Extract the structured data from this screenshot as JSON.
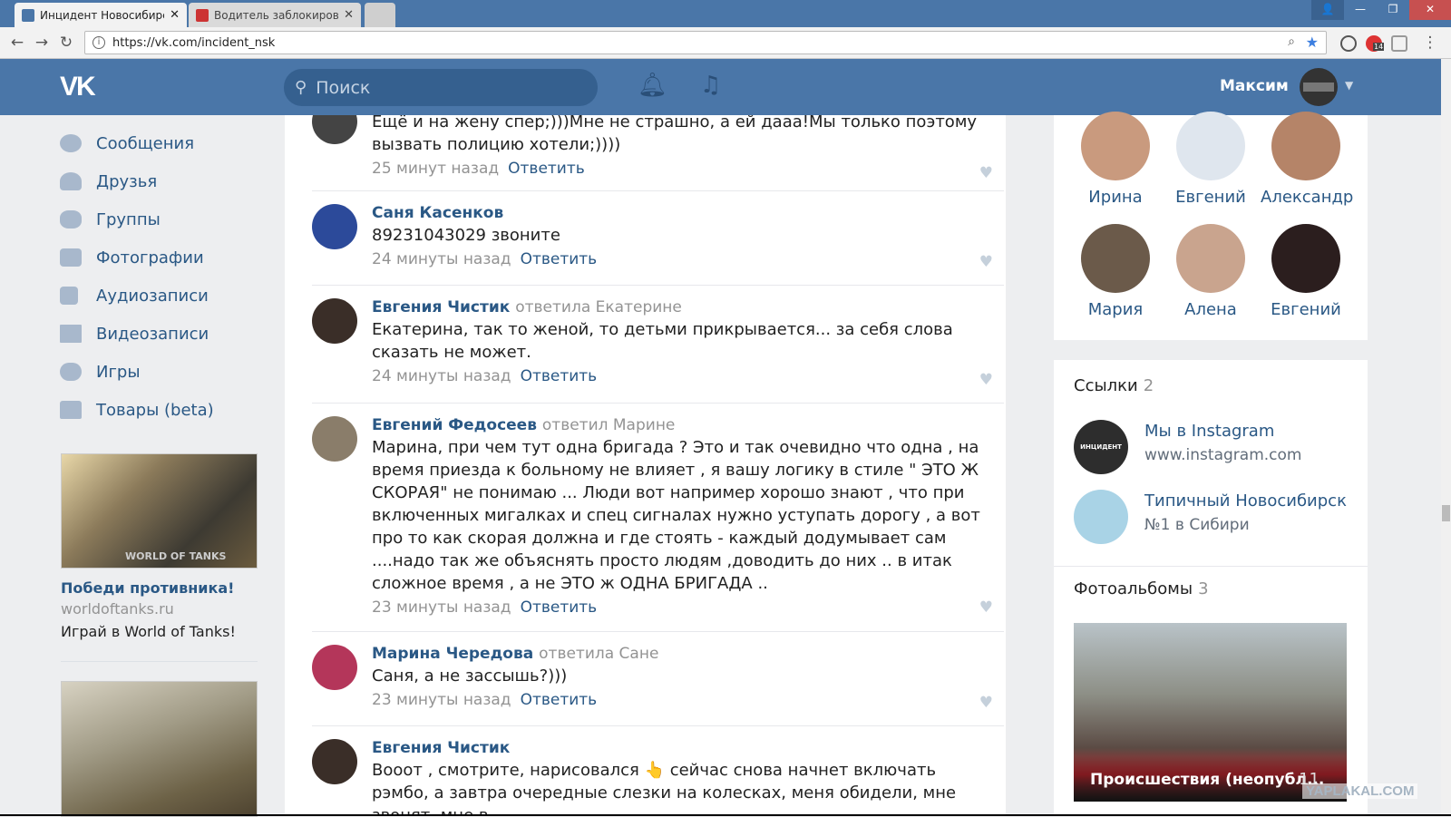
{
  "browser": {
    "tabs": [
      {
        "title": "Инцидент Новосибирск",
        "active": true
      },
      {
        "title": "Водитель заблокировал",
        "active": false
      }
    ],
    "url": "https://vk.com/incident_nsk",
    "ext_badge": "14"
  },
  "header": {
    "logo": "VK",
    "search_placeholder": "Поиск",
    "user_name": "Максим"
  },
  "leftnav": {
    "items": [
      {
        "label": "Сообщения"
      },
      {
        "label": "Друзья"
      },
      {
        "label": "Группы"
      },
      {
        "label": "Фотографии"
      },
      {
        "label": "Аудиозаписи"
      },
      {
        "label": "Видеозаписи"
      },
      {
        "label": "Игры"
      },
      {
        "label": "Товары (beta)"
      }
    ]
  },
  "ad": {
    "title": "Победи противника!",
    "domain": "worldoftanks.ru",
    "subtitle": "Играй в World of Tanks!",
    "img_text": "WORLD OF TANKS"
  },
  "comments": [
    {
      "name": "",
      "reply_to": "",
      "text": "Ещё и на жену спер;)))Мне не страшно, а ей дааа!Мы только поэтому вызвать полицию хотели;))))",
      "time": "25 минут назад",
      "reply": "Ответить"
    },
    {
      "name": "Саня Касенков",
      "reply_to": "",
      "text": "89231043029 звоните",
      "time": "24 минуты назад",
      "reply": "Ответить"
    },
    {
      "name": "Евгения Чистик",
      "reply_to": "ответила Екатерине",
      "text": "Екатерина, так то женой, то детьми прикрывается... за себя слова сказать не может.",
      "time": "24 минуты назад",
      "reply": "Ответить"
    },
    {
      "name": "Евгений Федосеев",
      "reply_to": "ответил Марине",
      "text": "Марина, при чем тут одна бригада ? Это и так очевидно что одна , на время приезда к больному не влияет , я вашу логику в стиле \" ЭТО Ж СКОРАЯ\" не понимаю ... Люди вот например хорошо знают , что при включенных мигалках и спец сигналах нужно уступать дорогу , а вот про то как скорая должна и где стоять - каждый додумывает сам ....надо так же объяснять просто людям ,доводить до них .. в итак сложное время , а не ЭТО ж ОДНА БРИГАДА ..",
      "time": "23 минуты назад",
      "reply": "Ответить"
    },
    {
      "name": "Марина Чередова",
      "reply_to": "ответила Сане",
      "text": "Саня, а не зассышь?)))",
      "time": "23 минуты назад",
      "reply": "Ответить"
    },
    {
      "name": "Евгения Чистик",
      "reply_to": "",
      "text": "Вооот , смотрите, нарисовался 👆 сейчас снова начнет включать рэмбо, а завтра очередные слезки на колесках, меня обидели, мне звонят, мне в",
      "time": "",
      "reply": ""
    }
  ],
  "friends": [
    {
      "name": "Ирина"
    },
    {
      "name": "Евгений"
    },
    {
      "name": "Александр"
    },
    {
      "name": "Мария"
    },
    {
      "name": "Алена"
    },
    {
      "name": "Евгений"
    }
  ],
  "links": {
    "title": "Ссылки",
    "count": "2",
    "items": [
      {
        "title": "Мы в Instagram",
        "url": "www.instagram.com",
        "avatar_text": "ИНЦИДЕНТ"
      },
      {
        "title": "Типичный Новосибирск",
        "url": "№1 в Сибири"
      }
    ]
  },
  "albums": {
    "title": "Фотоальбомы",
    "count": "3",
    "caption": "Происшествия (неопубл...",
    "photo_count": "11"
  },
  "watermark": "YAPLAKAL.COM"
}
